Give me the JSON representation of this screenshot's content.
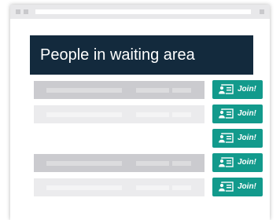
{
  "panel": {
    "title": "People in waiting area"
  },
  "colors": {
    "header_bg": "#132a3d",
    "join_button": "#129a8c",
    "row_dark": "#cbcbcf",
    "row_light": "#ebebed",
    "placeholder": "#ffffff"
  },
  "rows": [
    {
      "shade": "dark",
      "join_label": "Join!",
      "join_icon": "person-card-icon"
    },
    {
      "shade": "light",
      "join_label": "Join!",
      "join_icon": "person-card-icon"
    },
    {
      "shade": "blank",
      "join_label": "Join!",
      "join_icon": "person-card-icon"
    },
    {
      "shade": "dark",
      "join_label": "Join!",
      "join_icon": "person-card-icon"
    },
    {
      "shade": "light",
      "join_label": "Join!",
      "join_icon": "person-card-icon"
    }
  ]
}
